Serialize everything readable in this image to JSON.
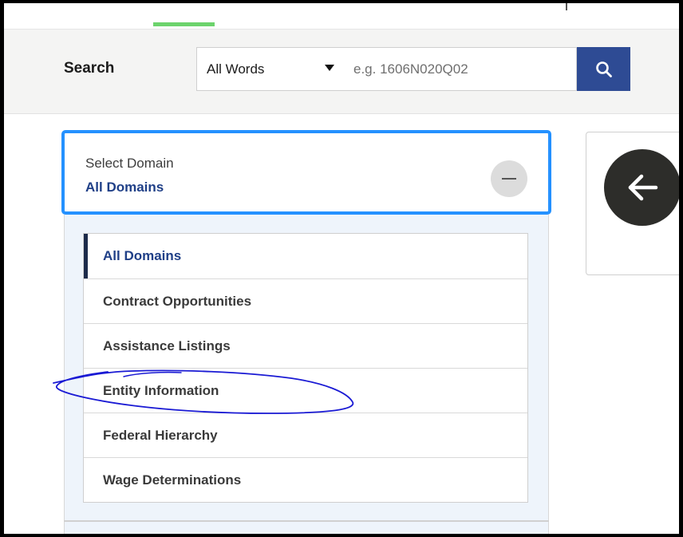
{
  "search": {
    "label": "Search",
    "mode_selected": "All Words",
    "placeholder": "e.g. 1606N020Q02",
    "button_icon": "search-icon"
  },
  "domain_selector": {
    "caption": "Select Domain",
    "selected_value": "All Domains",
    "toggle_icon": "minus-icon",
    "accent_color": "#2491ff",
    "items": [
      {
        "label": "All Domains",
        "active": true
      },
      {
        "label": "Contract Opportunities",
        "active": false
      },
      {
        "label": "Assistance Listings",
        "active": false
      },
      {
        "label": "Entity Information",
        "active": false
      },
      {
        "label": "Federal Hierarchy",
        "active": false
      },
      {
        "label": "Wage Determinations",
        "active": false
      }
    ]
  },
  "side_card": {
    "back_icon": "arrow-left-icon"
  },
  "colors": {
    "search_button": "#2e4b94",
    "active_tab": "#6cd36c",
    "link_blue": "#1f3f87",
    "annotation_ink": "#1a1ad4"
  }
}
